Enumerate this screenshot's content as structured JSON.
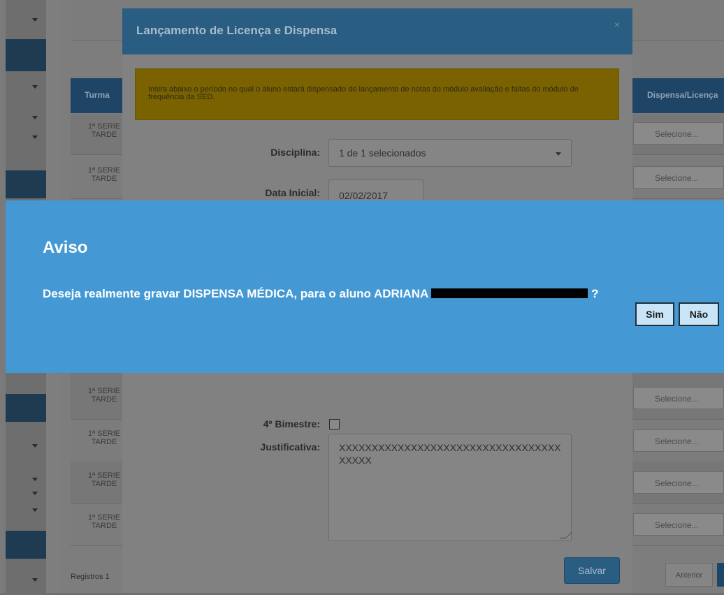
{
  "background": {
    "table": {
      "headers": {
        "turma": "Turma",
        "dispensa": "Dispensa/Licença"
      },
      "rows": [
        {
          "turma": "1ª SERIE TARDE",
          "select": "Selecione..."
        },
        {
          "turma": "1ª SERIE TARDE",
          "select": "Selecione..."
        },
        {
          "turma": "1ª SERIE TARDE",
          "select": "Selecione..."
        },
        {
          "turma": "1ª SERIE TARDE",
          "select": "Selecione..."
        },
        {
          "turma": "1ª SERIE TARDE",
          "select": "Selecione..."
        },
        {
          "turma": "1ª SERIE TARDE",
          "select": "Selecione..."
        }
      ]
    },
    "records_label": "Registros 1",
    "prev_label": "Anterior"
  },
  "modal": {
    "title": "Lançamento de Licença e Dispensa",
    "close_glyph": "×",
    "alert": "Insira abaixo o período no qual o aluno estará dispensado do lançamento de notas do módulo avaliação e faltas do módulo de frequência da SED.",
    "disciplina_label": "Disciplina:",
    "disciplina_value": "1 de 1 selecionados",
    "data_inicial_label": "Data Inicial:",
    "data_inicial_value": "02/02/2017",
    "bimestre4_label": "4º Bimestre:",
    "justificativa_label": "Justificativa:",
    "justificativa_value": "XXXXXXXXXXXXXXXXXXXXXXXXXXXXXXXXXXXXXXX",
    "save_label": "Salvar"
  },
  "aviso": {
    "title": "Aviso",
    "message_prefix": "Deseja realmente gravar DISPENSA MÉDICA, para o aluno ADRIANA",
    "message_suffix": "?",
    "yes_label": "Sim",
    "no_label": "Não"
  },
  "colors": {
    "aviso_bg": "#4499d4",
    "aviso_button_bg": "#c9e4f7",
    "modal_header": "#2a5d82",
    "alert_bg": "#7a6200"
  }
}
